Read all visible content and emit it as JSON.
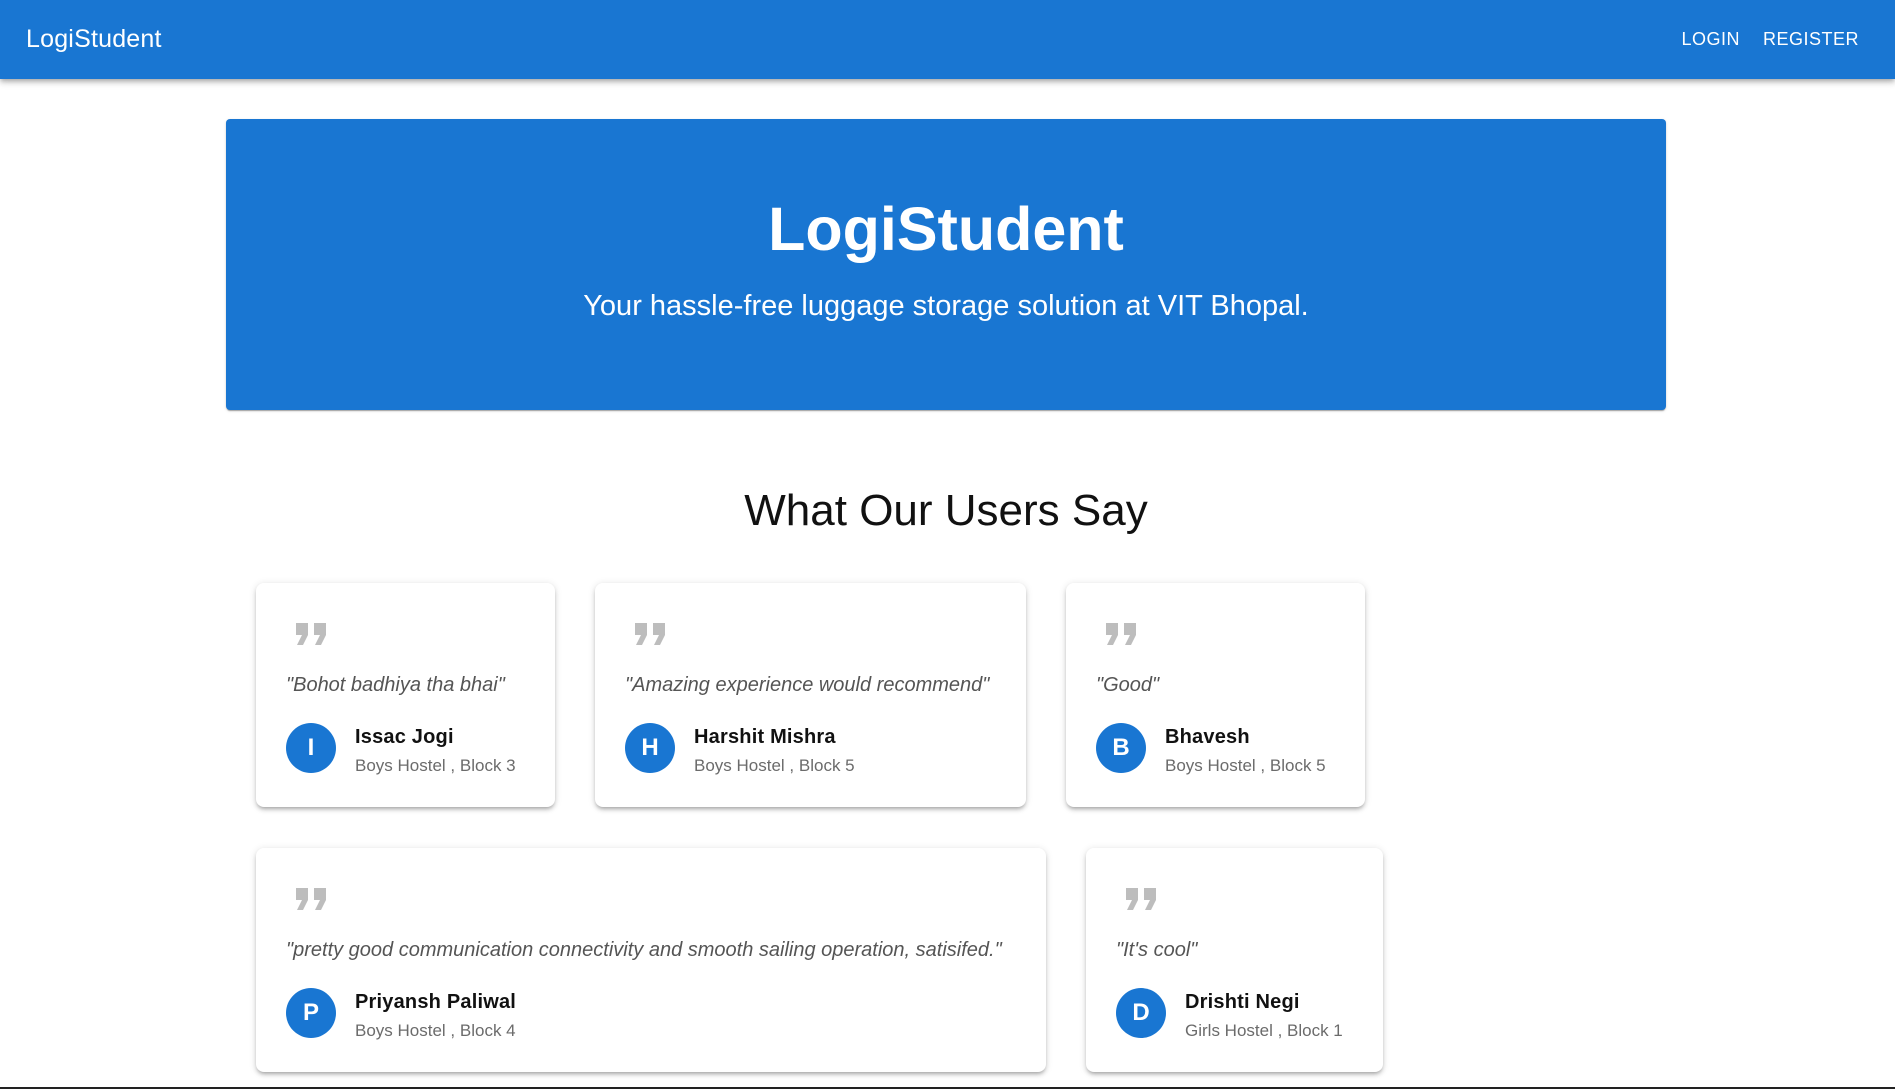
{
  "appbar": {
    "brand": "LogiStudent",
    "login_label": "LOGIN",
    "register_label": "REGISTER"
  },
  "hero": {
    "title": "LogiStudent",
    "subtitle": "Your hassle-free luggage storage solution at VIT Bhopal."
  },
  "testimonials": {
    "heading": "What Our Users Say",
    "quote_icon": "format-quote-icon",
    "items": [
      {
        "quote": "\"Bohot badhiya tha bhai\"",
        "initial": "I",
        "name": "Issac Jogi",
        "location": "Boys Hostel , Block 3"
      },
      {
        "quote": "\"Amazing experience would recommend\"",
        "initial": "H",
        "name": "Harshit Mishra",
        "location": "Boys Hostel , Block 5"
      },
      {
        "quote": "\"Good\"",
        "initial": "B",
        "name": "Bhavesh",
        "location": "Boys Hostel , Block 5"
      },
      {
        "quote": "\"pretty good communication connectivity and smooth sailing operation, satisifed.\"",
        "initial": "P",
        "name": "Priyansh Paliwal",
        "location": "Boys Hostel , Block 4"
      },
      {
        "quote": "\"It's cool\"",
        "initial": "D",
        "name": "Drishti Negi",
        "location": "Girls Hostel , Block 1"
      }
    ]
  },
  "colors": {
    "primary": "#1976d2",
    "quote_icon": "#bdbdbd",
    "secondary_text": "#6b6b6b"
  }
}
